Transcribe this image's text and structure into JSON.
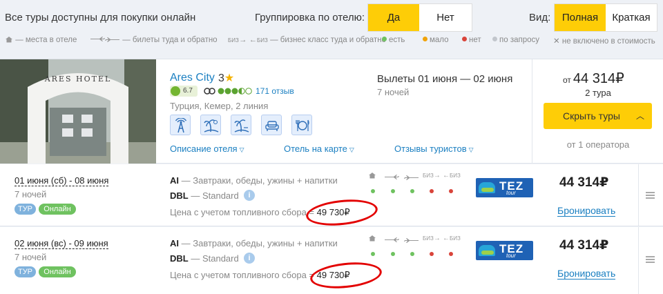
{
  "topbar": {
    "all_online": "Все туры доступны для покупки онлайн",
    "group_label": "Группировка по отелю:",
    "group_yes": "Да",
    "group_no": "Нет",
    "view_label": "Вид:",
    "view_full": "Полная",
    "view_short": "Краткая"
  },
  "legend": {
    "hotel_places": "— места в отеле",
    "flights": "— билеты туда и обратно",
    "biz_icon": "БИЗ",
    "business": "— бизнес класс туда и обратно",
    "available": "есть",
    "few": "мало",
    "none": "нет",
    "on_request": "по запросу",
    "not_included": "не включено в стоимость"
  },
  "colors": {
    "accent": "#fecd07",
    "link": "#1a7fc1",
    "green": "#6fc260",
    "orange": "#f0a30a",
    "red": "#d9443a"
  },
  "hotel": {
    "name": "Ares City",
    "stars": "3",
    "photo_sign": "ARES HOTEL",
    "rating": "6.7",
    "tripadvisor_score": 3.5,
    "reviews": "171 отзыв",
    "location": "Турция, Кемер, 2 линия",
    "amenities": [
      "wifi-icon",
      "beach-icon",
      "beach-palm-icon",
      "sofa-icon",
      "restaurant-icon"
    ],
    "link_description": "Описание отеля",
    "link_map": "Отель на карте",
    "link_reviews": "Отзывы туристов",
    "dates_title": "Вылеты 01 июня — 02 июня",
    "nights": "7 ночей",
    "price_from_prefix": "от",
    "price_from": "44 314",
    "currency": "₽",
    "tours_count": "2 тура",
    "hide_button": "Скрыть туры",
    "operators": "от 1 оператора"
  },
  "offers": [
    {
      "dates": "01 июня (сб) - 08 июня",
      "nights": "7 ночей",
      "badge_tour": "ТУР",
      "badge_online": "Онлайн",
      "meal_code": "AI",
      "meal_desc": "— Завтраки, обеды, ужины + напитки",
      "room_code": "DBL",
      "room_desc": "— Standard",
      "fuel_label": "Цена с учетом топливного сбора =",
      "fuel_price": "49 730",
      "operator": "TEZ",
      "operator_sub": "tour",
      "price": "44 314",
      "book": "Бронировать",
      "availability": [
        "green",
        "green",
        "green",
        "red",
        "red"
      ]
    },
    {
      "dates": "02 июня (вс) - 09 июня",
      "nights": "7 ночей",
      "badge_tour": "ТУР",
      "badge_online": "Онлайн",
      "meal_code": "AI",
      "meal_desc": "— Завтраки, обеды, ужины + напитки",
      "room_code": "DBL",
      "room_desc": "— Standard",
      "fuel_label": "Цена с учетом топливного сбора =",
      "fuel_price": "49 730",
      "operator": "TEZ",
      "operator_sub": "tour",
      "price": "44 314",
      "book": "Бронировать",
      "availability": [
        "green",
        "green",
        "green",
        "red",
        "red"
      ]
    }
  ]
}
